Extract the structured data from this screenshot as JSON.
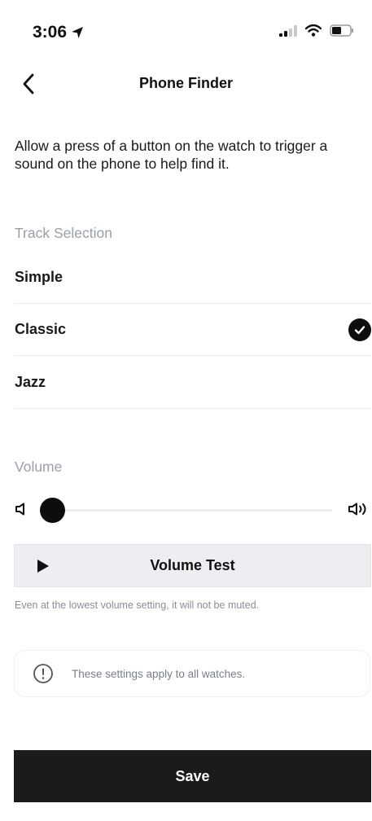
{
  "status_bar": {
    "time": "3:06"
  },
  "header": {
    "title": "Phone Finder"
  },
  "description": "Allow a press of a button on the watch to trigger a sound on the phone to help find it.",
  "track_selection": {
    "label": "Track Selection",
    "items": [
      {
        "label": "Simple",
        "selected": false
      },
      {
        "label": "Classic",
        "selected": true
      },
      {
        "label": "Jazz",
        "selected": false
      }
    ]
  },
  "volume": {
    "label": "Volume",
    "level": 0,
    "test_label": "Volume Test",
    "note": "Even at the lowest volume setting, it will not be muted."
  },
  "info": {
    "text": "These settings apply to all watches."
  },
  "save_label": "Save"
}
